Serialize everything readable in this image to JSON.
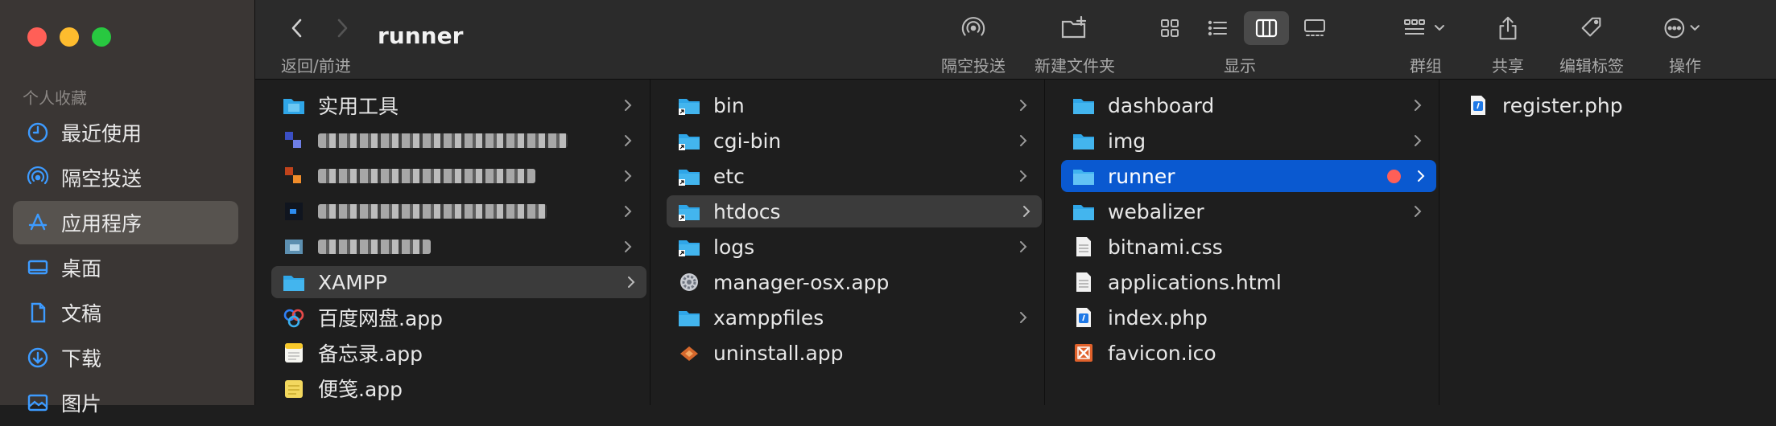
{
  "window": {
    "title": "runner",
    "nav_caption": "返回/前进"
  },
  "toolbar": {
    "airdrop": "隔空投送",
    "new_folder": "新建文件夹",
    "view": "显示",
    "group": "群组",
    "share": "共享",
    "edit_tags": "编辑标签",
    "action": "操作"
  },
  "sidebar": {
    "section": "个人收藏",
    "items": [
      {
        "label": "最近使用",
        "icon": "clock-icon"
      },
      {
        "label": "隔空投送",
        "icon": "airdrop-icon"
      },
      {
        "label": "应用程序",
        "icon": "apps-icon",
        "selected": true
      },
      {
        "label": "桌面",
        "icon": "desktop-icon"
      },
      {
        "label": "文稿",
        "icon": "document-icon"
      },
      {
        "label": "下载",
        "icon": "download-icon"
      },
      {
        "label": "图片",
        "icon": "picture-icon"
      }
    ]
  },
  "columns": {
    "col1": [
      {
        "label": "实用工具",
        "chevron": true
      },
      {
        "label": "",
        "redacted": true,
        "chevron": true
      },
      {
        "label": "",
        "redacted": true,
        "chevron": true
      },
      {
        "label": "",
        "redacted": true,
        "chevron": true
      },
      {
        "label": "",
        "redacted": true,
        "chevron": true
      },
      {
        "label": "XAMPP",
        "chevron": true,
        "highlight": true
      },
      {
        "label": "百度网盘.app"
      },
      {
        "label": "备忘录.app"
      },
      {
        "label": "便笺.app"
      }
    ],
    "col2": [
      {
        "label": "bin",
        "chevron": true
      },
      {
        "label": "cgi-bin",
        "chevron": true
      },
      {
        "label": "etc",
        "chevron": true
      },
      {
        "label": "htdocs",
        "chevron": true,
        "highlight": true
      },
      {
        "label": "logs",
        "chevron": true
      },
      {
        "label": "manager-osx.app"
      },
      {
        "label": "xamppfiles",
        "chevron": true
      },
      {
        "label": "uninstall.app"
      }
    ],
    "col3": [
      {
        "label": "dashboard",
        "chevron": true
      },
      {
        "label": "img",
        "chevron": true
      },
      {
        "label": "runner",
        "chevron": true,
        "selected": true,
        "tag": "red"
      },
      {
        "label": "webalizer",
        "chevron": true
      },
      {
        "label": "bitnami.css"
      },
      {
        "label": "applications.html"
      },
      {
        "label": "index.php"
      },
      {
        "label": "favicon.ico"
      }
    ],
    "col4": [
      {
        "label": "register.php"
      }
    ]
  },
  "colors": {
    "accent": "#0a59d0",
    "tag_red": "#fe5f57",
    "folder": "#2fa6e8"
  }
}
